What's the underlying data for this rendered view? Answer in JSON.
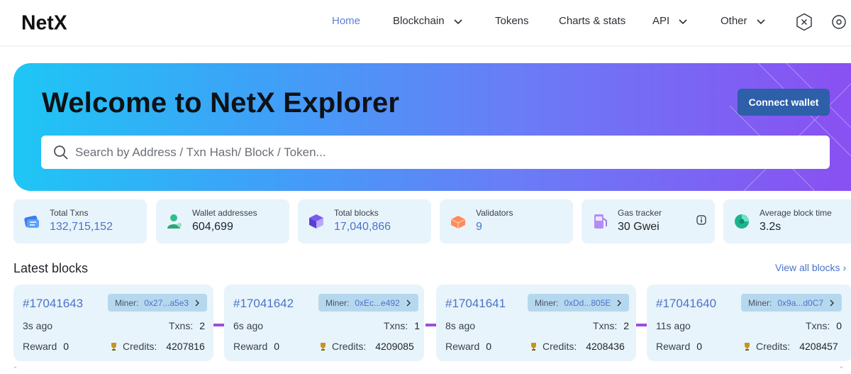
{
  "brand": {
    "logo_text": "NetX"
  },
  "nav": {
    "items": [
      {
        "label": "Home",
        "active": true,
        "dropdown": false
      },
      {
        "label": "Blockchain",
        "active": false,
        "dropdown": true
      },
      {
        "label": "Tokens",
        "active": false,
        "dropdown": false
      },
      {
        "label": "Charts & stats",
        "active": false,
        "dropdown": false
      },
      {
        "label": "API",
        "active": false,
        "dropdown": true
      },
      {
        "label": "Other",
        "active": false,
        "dropdown": true
      }
    ],
    "network_icon": "hexagon-x-icon"
  },
  "hero": {
    "title": "Welcome to NetX Explorer",
    "connect_wallet": "Connect wallet",
    "search_placeholder": "Search by Address / Txn Hash/ Block / Token..."
  },
  "stats": [
    {
      "label": "Total Txns",
      "value": "132,715,152",
      "icon": "transactions-icon"
    },
    {
      "label": "Wallet addresses",
      "value": "604,699",
      "icon": "wallet-user-icon"
    },
    {
      "label": "Total blocks",
      "value": "17,040,866",
      "icon": "blocks-icon"
    },
    {
      "label": "Validators",
      "value": "9",
      "icon": "validators-icon"
    },
    {
      "label": "Gas tracker",
      "value": "30 Gwei",
      "icon": "gas-pump-icon"
    },
    {
      "label": "Average block time",
      "value": "3.2s",
      "icon": "clock-icon"
    }
  ],
  "latest_blocks": {
    "title": "Latest blocks",
    "view_all": "View all blocks",
    "miner_label": "Miner:",
    "txns_label": "Txns:",
    "reward_label": "Reward",
    "credits_label": "Credits:",
    "blocks": [
      {
        "number": "#17041643",
        "miner": "0x27...a5e3",
        "age": "3s ago",
        "txns": "2",
        "reward": "0",
        "credits": "4207816"
      },
      {
        "number": "#17041642",
        "miner": "0xEc...e492",
        "age": "6s ago",
        "txns": "1",
        "reward": "0",
        "credits": "4209085"
      },
      {
        "number": "#17041641",
        "miner": "0xDd...805E",
        "age": "8s ago",
        "txns": "2",
        "reward": "0",
        "credits": "4208436"
      },
      {
        "number": "#17041640",
        "miner": "0x9a...d0C7",
        "age": "11s ago",
        "txns": "0",
        "reward": "0",
        "credits": "4208457"
      }
    ]
  },
  "colors": {
    "accent": "#4a74c9",
    "connect_button": "#2e5fa9",
    "card_bg": "#e8f4fb",
    "connector": "#9b4de0"
  }
}
